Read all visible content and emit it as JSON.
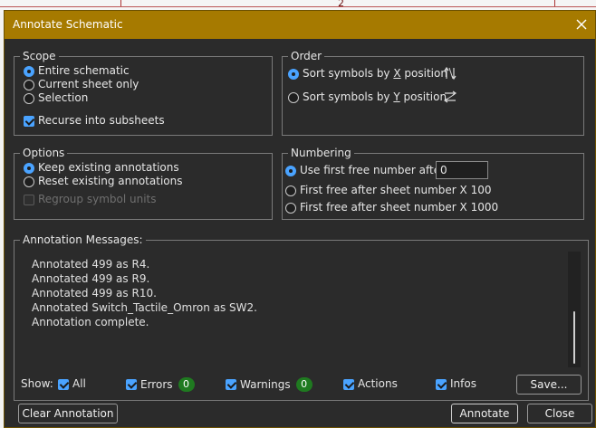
{
  "dialog": {
    "title": "Annotate Schematic",
    "background_mark": "2"
  },
  "scope": {
    "legend": "Scope",
    "options": [
      {
        "label": "Entire schematic",
        "selected": true
      },
      {
        "label": "Current sheet only",
        "selected": false
      },
      {
        "label": "Selection",
        "selected": false
      }
    ],
    "recurse": {
      "label": "Recurse into subsheets",
      "checked": true
    }
  },
  "order": {
    "legend": "Order",
    "options": [
      {
        "label_pre": "Sort symbols by ",
        "label_key": "X",
        "label_post": " position",
        "selected": true,
        "icon": "sort-by-x-icon"
      },
      {
        "label_pre": "Sort symbols by ",
        "label_key": "Y",
        "label_post": " position",
        "selected": false,
        "icon": "sort-by-y-icon"
      }
    ]
  },
  "options": {
    "legend": "Options",
    "items": [
      {
        "label": "Keep existing annotations",
        "selected": true
      },
      {
        "label": "Reset existing annotations",
        "selected": false
      }
    ],
    "regroup": {
      "label": "Regroup symbol units",
      "checked": false,
      "disabled": true
    }
  },
  "numbering": {
    "legend": "Numbering",
    "items": [
      {
        "label": "Use first free number after:",
        "selected": true
      },
      {
        "label": "First free after sheet number X 100",
        "selected": false
      },
      {
        "label": "First free after sheet number X 1000",
        "selected": false
      }
    ],
    "start_value": "0"
  },
  "messages": {
    "legend": "Annotation Messages:",
    "lines": [
      "Annotated 499 as R4.",
      "Annotated 499 as R9.",
      "Annotated 499 as R10.",
      "Annotated Switch_Tactile_Omron as SW2.",
      "Annotation complete."
    ],
    "show_label": "Show:",
    "filters": {
      "all": {
        "label": "All",
        "checked": true
      },
      "errors": {
        "label": "Errors",
        "checked": true,
        "count": "0"
      },
      "warnings": {
        "label": "Warnings",
        "checked": true,
        "count": "0"
      },
      "actions": {
        "label": "Actions",
        "checked": true
      },
      "infos": {
        "label": "Infos",
        "checked": true
      }
    },
    "save_label": "Save..."
  },
  "buttons": {
    "clear": "Clear Annotation",
    "annotate": "Annotate",
    "close": "Close"
  },
  "colors": {
    "titlebar": "#a67a00",
    "accent": "#4aa3ff",
    "badge": "#1f7a20",
    "dialog_bg": "#2b2b2b"
  }
}
